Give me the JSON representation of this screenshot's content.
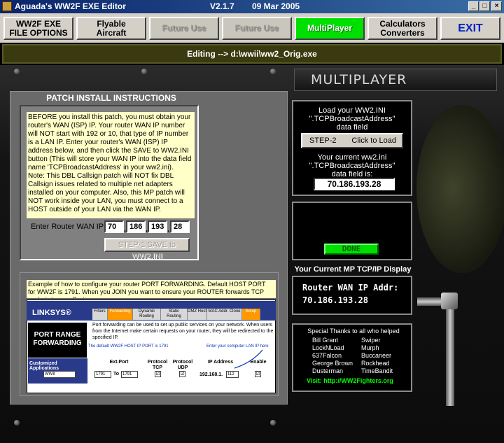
{
  "titlebar": {
    "title": "Aguada's WW2F EXE Editor",
    "version": "V2.1.7",
    "date": "09 Mar 2005",
    "min": "_",
    "max": "□",
    "close": "×"
  },
  "toolbar": {
    "file_options": [
      "WW2F EXE",
      "FILE OPTIONS"
    ],
    "flyable": [
      "Flyable",
      "Aircraft"
    ],
    "future1": "Future Use",
    "future2": "Future Use",
    "multiplayer": "MultiPlayer",
    "calculators": [
      "Calculators",
      "Converters"
    ],
    "exit": "EXIT"
  },
  "editing": "Editing --> d:\\wwii\\ww2_Orig.exe",
  "mp_title": "MULTIPLAYER",
  "patch": {
    "title": "PATCH INSTALL INSTRUCTIONS",
    "instructions": "BEFORE you install this patch, you must obtain your router's WAN (ISP) IP.  Your router WAN IP number will NOT start with 192 or 10, that type of IP number is a LAN IP.  Enter your router's WAN (ISP) IP address below, and then click the SAVE to WW2.INI button (This will store your WAN IP into the data field name 'TCPBroadcastAddress' in your ww2.ini).\nNote: This DBL Callsign patch will NOT fix DBL Callsign issues related to multiple net adapters installed on your computer.  Also, this MP patch will NOT work inside your LAN, you must connect to a HOST outside of your LAN via the WAN IP.",
    "wan_label": "Enter Router WAN IP -->",
    "oct1": "70",
    "oct2": "186",
    "oct3": "193",
    "oct4": "28",
    "save_button": "STEP-1  SAVE to WW2.INI"
  },
  "router": {
    "note": "Example of how to configure your router PORT FORWARDING.  Default HOST PORT for WW2F is 1791.  When you JOIN you want to ensure your ROUTER forwards TCP packets to your System.",
    "brand": "LINKSYS®",
    "tabs": [
      "Filters",
      "Forwarding",
      "Dynamic Routing",
      "Static Routing",
      "DMZ Host",
      "MAC Addr. Clone",
      "Setup"
    ],
    "prf": [
      "PORT RANGE",
      "FORWARDING"
    ],
    "desc": "Port forwarding can be used to set up public services on your network. When users from the Internet make certain requests on your router, they will be redirected to the specified IP.",
    "default_port_note": "The default WW2F HOST IP PORT is 1791",
    "lan_ip_note": "Enter your computer LAN IP here",
    "customized": "Customized Applications",
    "cols": [
      "Ext.Port",
      "Protocol TCP",
      "Protocol UDP",
      "IP Address",
      "Enable"
    ],
    "app_name": "WWII",
    "port_from": "1791",
    "port_to": "1791",
    "to_label": "To",
    "ip_prefix": "192.168.1.",
    "ip_last": "112",
    "check": "☑"
  },
  "load_panel": {
    "l1": "Load your WW2.INI",
    "l2": "\".TCPBroadcastAddress\"",
    "l3": "data field",
    "step2_left": "STEP-2",
    "step2_right": "Click to Load",
    "c1": "Your current ww2.ini",
    "c2": "\".TCPBroadcastAddress\"",
    "c3": "data field is:",
    "current_ip": "70.186.193.28"
  },
  "done": "DONE",
  "tcpip": {
    "title": "Your Current MP TCP/IP Display",
    "label": "Router  WAN IP Addr:",
    "ip": "70.186.193.28"
  },
  "thanks": {
    "header": "Special Thanks to all who helped",
    "col1": [
      "Bill Grant",
      "LockNLoad",
      "637Falcon",
      "George Brown",
      "Dusterman"
    ],
    "col2": [
      "Swiper",
      "Murph",
      "Buccaneer",
      "Rockhead",
      "TimeBandit"
    ],
    "visit": "Visit:  http://WW2Fighters.org"
  }
}
